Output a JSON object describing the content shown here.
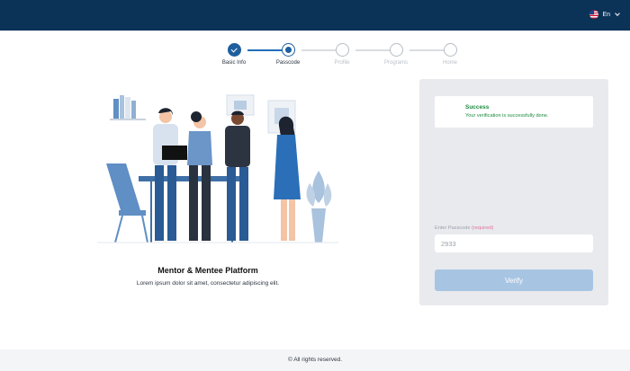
{
  "header": {
    "language": {
      "icon": "us-flag-icon",
      "label": "En"
    }
  },
  "stepper": {
    "steps": [
      {
        "label": "Basic Info",
        "state": "done"
      },
      {
        "label": "Passcode",
        "state": "active"
      },
      {
        "label": "Profile",
        "state": "pending"
      },
      {
        "label": "Programs",
        "state": "pending"
      },
      {
        "label": "Home",
        "state": "pending"
      }
    ]
  },
  "hero": {
    "title": "Mentor & Mentee Platform",
    "description": "Lorem ipsum dolor sit amet, consectetur adipiscing elit."
  },
  "alert": {
    "title": "Success",
    "message": "Your verification is successfully done."
  },
  "form": {
    "passcode_label": "Enter Passcode",
    "required_label": "(required)",
    "passcode_value": "2933",
    "verify_label": "Verify"
  },
  "footer": {
    "text": "© All rights reserved."
  },
  "colors": {
    "header": "#0b3358",
    "accent": "#1f5f9e",
    "success": "#1c8a3d",
    "verify_button": "#a7c5e3",
    "panel": "#e9eaee"
  }
}
